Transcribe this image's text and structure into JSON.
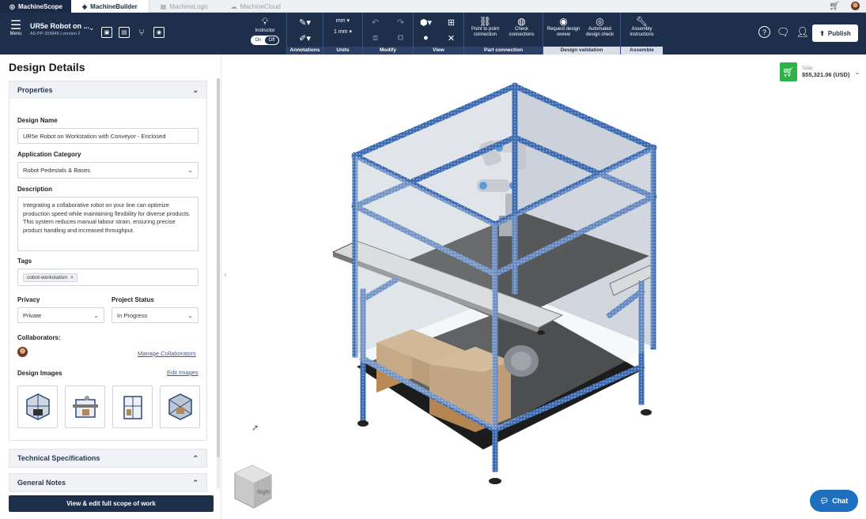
{
  "tabs": {
    "brand": "MachineScope",
    "items": [
      {
        "label": "MachineBuilder",
        "icon": "cube-icon",
        "active": true
      },
      {
        "label": "MachineLogic",
        "icon": "logic-icon",
        "active": false
      },
      {
        "label": "MachineCloud",
        "icon": "cloud-icon",
        "active": false
      }
    ]
  },
  "toolbar": {
    "menu_label": "Menu",
    "project_title": "UR5e Robot on ...",
    "project_subtitle": "AS-PP-355846 | version 2",
    "instructor_label": "Instructor",
    "toggle_on": "On",
    "toggle_off": "Off",
    "units_value_1": "mm",
    "units_value_2": "1 mm",
    "groups": {
      "annotations": "Annotations",
      "units": "Units",
      "modify": "Modify",
      "view": "View",
      "part_connection": "Part connection",
      "design_validation": "Design validation",
      "assemble": "Assemble"
    },
    "buttons": {
      "point_to_point": "Point to point connection",
      "check_connections": "Check connections",
      "request_review": "Request design review",
      "automated_check": "Automated design check",
      "assembly_instructions": "Assembly instructions"
    },
    "publish_label": "Publish"
  },
  "panel": {
    "title": "Design Details",
    "properties_header": "Properties",
    "design_name_label": "Design Name",
    "design_name_value": "UR5e Robot on Workstation with Conveyor - Enclosed",
    "app_category_label": "Application Category",
    "app_category_value": "Robot Pedestals & Bases",
    "description_label": "Description",
    "description_value": "Integrating a collaborative robot on your line can optimize production speed while maintaining flexibility for diverse products. This system reduces manual labour strain, ensuring precise product handling and increased throughput.",
    "tags_label": "Tags",
    "tag_1": "cobot-workstation",
    "privacy_label": "Privacy",
    "privacy_value": "Private",
    "status_label": "Project Status",
    "status_value": "In Progress",
    "collaborators_label": "Collaborators:",
    "manage_collaborators": "Manage Collaborators",
    "design_images_label": "Design Images",
    "edit_images": "Edit Images",
    "tech_specs_header": "Technical Specifications",
    "general_notes_header": "General Notes",
    "cta_label": "View & edit full scope of work"
  },
  "viewport": {
    "total_label": "Total:",
    "total_value": "$55,321.06 (USD)",
    "view_cube_label": "Right",
    "chat_label": "Chat"
  }
}
